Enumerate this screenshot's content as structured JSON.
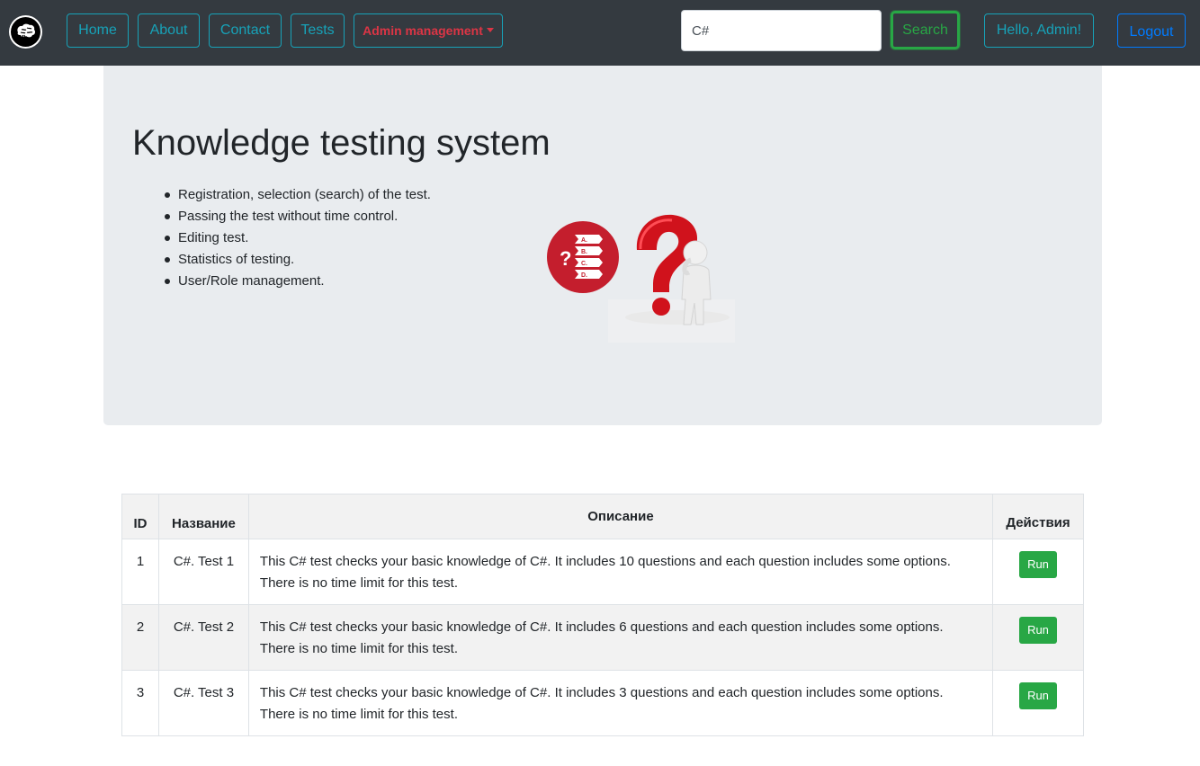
{
  "navbar": {
    "brand_icon": "brain-icon",
    "links": {
      "home": "Home",
      "about": "About",
      "contact": "Contact",
      "tests": "Tests",
      "admin": "Admin management"
    },
    "search": {
      "value": "C#",
      "button": "Search"
    },
    "user_greeting": "Hello, Admin!",
    "logout": "Logout"
  },
  "jumbotron": {
    "title": "Knowledge testing system",
    "features": [
      "Registration, selection (search) of the test.",
      "Passing the test without time control.",
      "Editing test.",
      "Statistics of testing.",
      "User/Role management."
    ],
    "illustration_icon": "question-person-icon",
    "quiz_badge_letters": [
      "A.",
      "B.",
      "C.",
      "D."
    ]
  },
  "table": {
    "headers": {
      "id": "ID",
      "name": "Название",
      "description": "Описание",
      "actions": "Действия"
    },
    "rows": [
      {
        "id": "1",
        "name": "C#. Test 1",
        "description": "This C# test checks your basic knowledge of C#. It includes 10 questions and each question includes some options. There is no time limit for this test.",
        "action": "Run"
      },
      {
        "id": "2",
        "name": "C#. Test 2",
        "description": "This C# test checks your basic knowledge of C#. It includes 6 questions and each question includes some options. There is no time limit for this test.",
        "action": "Run"
      },
      {
        "id": "3",
        "name": "C#. Test 3",
        "description": "This C# test checks your basic knowledge of C#. It includes 3 questions and each question includes some options. There is no time limit for this test.",
        "action": "Run"
      }
    ]
  },
  "colors": {
    "navbar_bg": "#343a40",
    "info": "#17a2b8",
    "danger": "#dc3545",
    "success": "#28a745",
    "primary": "#007bff",
    "jumbotron_bg": "#e9ecef"
  }
}
